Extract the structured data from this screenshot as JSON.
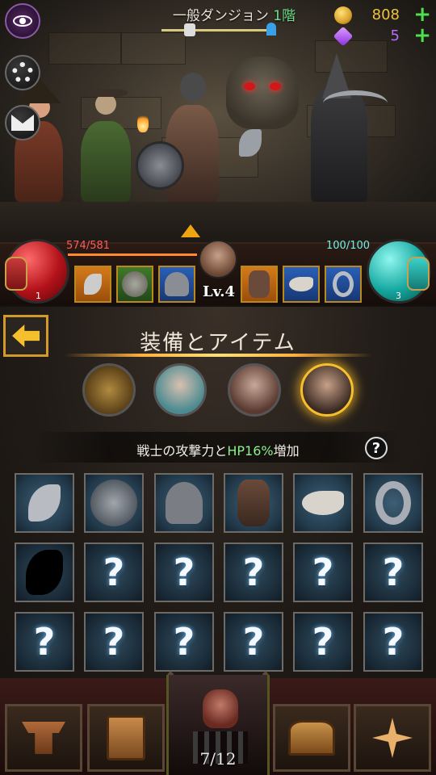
{
  "header": {
    "dungeon_name": "一般ダンジョン",
    "dungeon_floor": "1階",
    "gold": "808",
    "gems": "5",
    "gold_plus": "+",
    "gems_plus": "+"
  },
  "hud": {
    "hp_text": "574/581",
    "mp_text": "100/100",
    "hp_potion_count": "1",
    "mp_potion_count": "3",
    "level": "Lv.4",
    "equipped_slots": [
      {
        "icon": "axe-icon",
        "color": "orange"
      },
      {
        "icon": "round-shield-icon",
        "color": "green"
      },
      {
        "icon": "helmet-icon",
        "color": "blue"
      },
      {
        "icon": "fur-armor-icon",
        "color": "orange"
      },
      {
        "icon": "bird-skull-icon",
        "color": "blue"
      },
      {
        "icon": "ring-icon",
        "color": "blue"
      }
    ]
  },
  "panel": {
    "title": "装備とアイテム",
    "bonus_prefix": "戦士の攻撃力と",
    "bonus_hp": "HP16%",
    "bonus_suffix": "増加",
    "help": "?",
    "tabs": [
      "treasure-chest-tab",
      "elf-tab",
      "rogue-tab",
      "warrior-tab"
    ],
    "active_tab": "warrior-tab"
  },
  "grid": {
    "unknown_mark": "?",
    "row1": [
      "axe",
      "round-shield",
      "helmet",
      "fur-armor",
      "bird-skull",
      "ring"
    ],
    "row2_first": "silhouette-axe"
  },
  "nav": {
    "counter": "7/12"
  },
  "colors": {
    "gold": "#d9a12a",
    "gem": "#b35cff",
    "plus": "#4ee04e",
    "floor_green": "#6ee08a",
    "hp_red": "#ff5a5a",
    "mp_cyan": "#6ff0e4",
    "active_tab_glow": "#f6c02c"
  }
}
